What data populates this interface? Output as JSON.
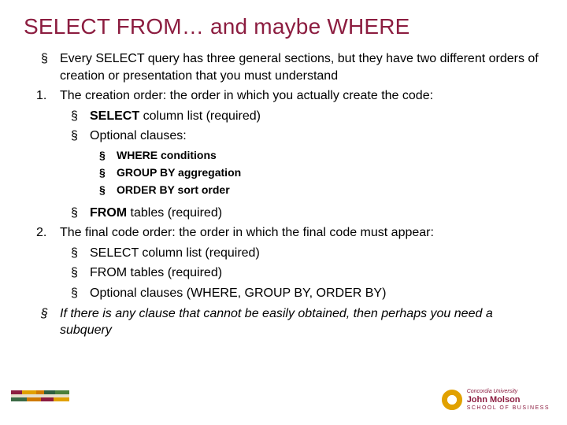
{
  "title": "SELECT FROM… and maybe WHERE",
  "bul_intro": "Every SELECT query has three general sections, but they have two different orders of creation or presentation that you must understand",
  "num1": "1.",
  "num1_text": "The creation order: the order in which you actually create the code:",
  "sel_lab": "SELECT",
  "sel_rest": " column list (required)",
  "opt": "Optional clauses:",
  "where_lab": "WHERE",
  "where_rest": " conditions",
  "group_lab": "GROUP BY",
  "group_rest": " aggregation",
  "order_lab": "ORDER BY",
  "order_rest": " sort order",
  "from_lab": "FROM",
  "from_rest": " tables (required)",
  "num2": "2.",
  "num2_text": "The final code order: the order in which the final code must appear:",
  "fc_select": "SELECT column list (required)",
  "fc_from": "FROM tables (required)",
  "fc_opt": "Optional clauses (WHERE, GROUP BY, ORDER BY)",
  "bul_outro": "If there is any clause that cannot be easily obtained, then perhaps you need a subquery",
  "logo": {
    "uni": "Concordia University",
    "school": "John Molson",
    "sub": "SCHOOL OF BUSINESS"
  }
}
